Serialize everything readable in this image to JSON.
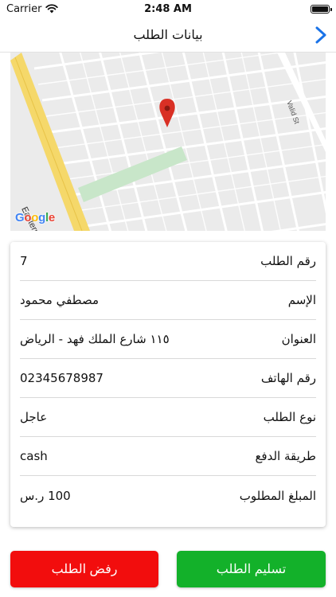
{
  "status_bar": {
    "carrier": "Carrier",
    "time": "2:48 AM"
  },
  "nav": {
    "title": "بيانات الطلب",
    "back_icon": "chevron-right-icon",
    "back_color": "#1a73e8"
  },
  "map": {
    "road_label": "Eastern Ring Rd",
    "street_label": "Valid St",
    "logo_parts": [
      "G",
      "o",
      "o",
      "g",
      "l",
      "e"
    ],
    "pin_color": "#d93025"
  },
  "details": [
    {
      "label": "رقم الطلب",
      "value": "7"
    },
    {
      "label": "الإسم",
      "value": "مصطفي محمود"
    },
    {
      "label": "العنوان",
      "value": "١١٥ شارع الملك فهد - الرياض"
    },
    {
      "label": "رقم الهاتف",
      "value": "02345678987"
    },
    {
      "label": "نوع الطلب",
      "value": "عاجل"
    },
    {
      "label": "طريقة الدفع",
      "value": "cash"
    },
    {
      "label": "المبلغ المطلوب",
      "value": "100  ر.س"
    }
  ],
  "actions": {
    "reject_label": "رفض الطلب",
    "deliver_label": "تسليم الطلب",
    "reject_color": "#f20d0d",
    "deliver_color": "#13b12a"
  }
}
